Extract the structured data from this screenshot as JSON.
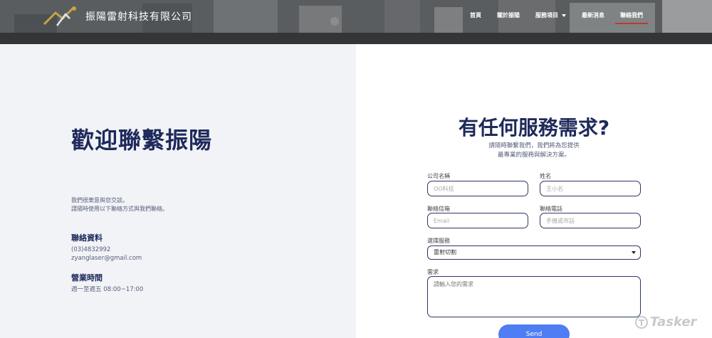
{
  "header": {
    "site_title": "振陽雷射科技有限公司",
    "nav": [
      {
        "label": "首頁"
      },
      {
        "label": "關於振陽"
      },
      {
        "label": "服務項目"
      },
      {
        "label": "最新消息"
      },
      {
        "label": "聯絡我們"
      }
    ]
  },
  "left": {
    "heading": "歡迎聯繫振陽",
    "intro_line1": "我們很樂意與您交談。",
    "intro_line2": "請隨時使用以下聯絡方式與我們聯絡。",
    "contact_heading": "聯絡資料",
    "phone": "(03)4832992",
    "email": "zyanglaser@gmail.com",
    "hours_heading": "營業時間",
    "hours": "週一至週五 08:00~17:00"
  },
  "form": {
    "title": "有任何服務需求?",
    "subtitle_line1": "請隨時聯繫我們，我們將為您提供",
    "subtitle_line2": "最專業的服務與解決方案。",
    "company_label": "公司名稱",
    "company_placeholder": "OO科技",
    "name_label": "姓名",
    "name_placeholder": "王小名",
    "email_label": "聯絡信箱",
    "email_placeholder": "Email",
    "phone_label": "聯絡電話",
    "phone_placeholder": "手機或市話",
    "service_label": "選擇服務",
    "service_value": "雷射切割",
    "needs_label": "需求",
    "needs_placeholder": "請輸入您的需求",
    "send_label": "Send"
  },
  "watermark": {
    "text": "Tasker"
  },
  "colors": {
    "navy": "#1e2a5a",
    "accent_blue": "#4f7df3",
    "nav_active_underline": "#c0392b",
    "left_bg": "#f2f3f7"
  }
}
